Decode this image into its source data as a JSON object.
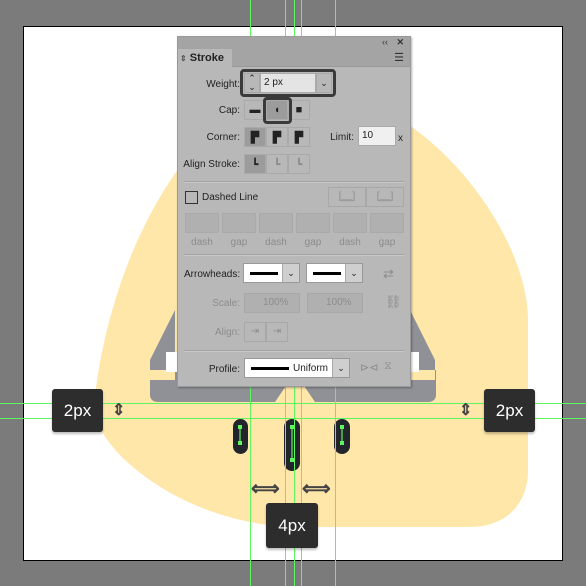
{
  "canvas": {
    "colors": {
      "artboard_bg": "#ffffff",
      "shape_fill": "#ffe6a9",
      "stand": "#909196",
      "guide": "#5ef55e",
      "pill": "#22252b",
      "anchor": "#5ef55e",
      "tag_bg": "#2d2d2d",
      "pasteboard": "#7b7b7b"
    }
  },
  "panel": {
    "title": "Stroke",
    "collapse_icon": "double-chevron-left",
    "close_icon": "x",
    "menu_icon": "hamburger",
    "weight": {
      "label": "Weight:",
      "value": "2 px"
    },
    "cap": {
      "label": "Cap:",
      "options": [
        "Butt Cap",
        "Round Cap",
        "Projecting Cap"
      ],
      "selected": "Round Cap"
    },
    "corner": {
      "label": "Corner:",
      "options": [
        "Miter Join",
        "Round Join",
        "Bevel Join"
      ],
      "selected": "Miter Join"
    },
    "limit": {
      "label": "Limit:",
      "value": "10",
      "suffix": "x"
    },
    "align_stroke": {
      "label": "Align Stroke:",
      "options": [
        "Align Center",
        "Align Inside",
        "Align Outside"
      ],
      "selected": "Align Center"
    },
    "dashed_line": {
      "label": "Dashed Line",
      "checked": false
    },
    "dash_fields": [
      "dash",
      "gap",
      "dash",
      "gap",
      "dash",
      "gap"
    ],
    "arrowheads": {
      "label": "Arrowheads:"
    },
    "scale": {
      "label": "Scale:",
      "start": "100%",
      "end": "100%"
    },
    "align": {
      "label": "Align:"
    },
    "profile": {
      "label": "Profile:",
      "value": "Uniform"
    }
  },
  "annotations": {
    "left_tag": "2px",
    "right_tag": "2px",
    "bottom_tag": "4px"
  }
}
